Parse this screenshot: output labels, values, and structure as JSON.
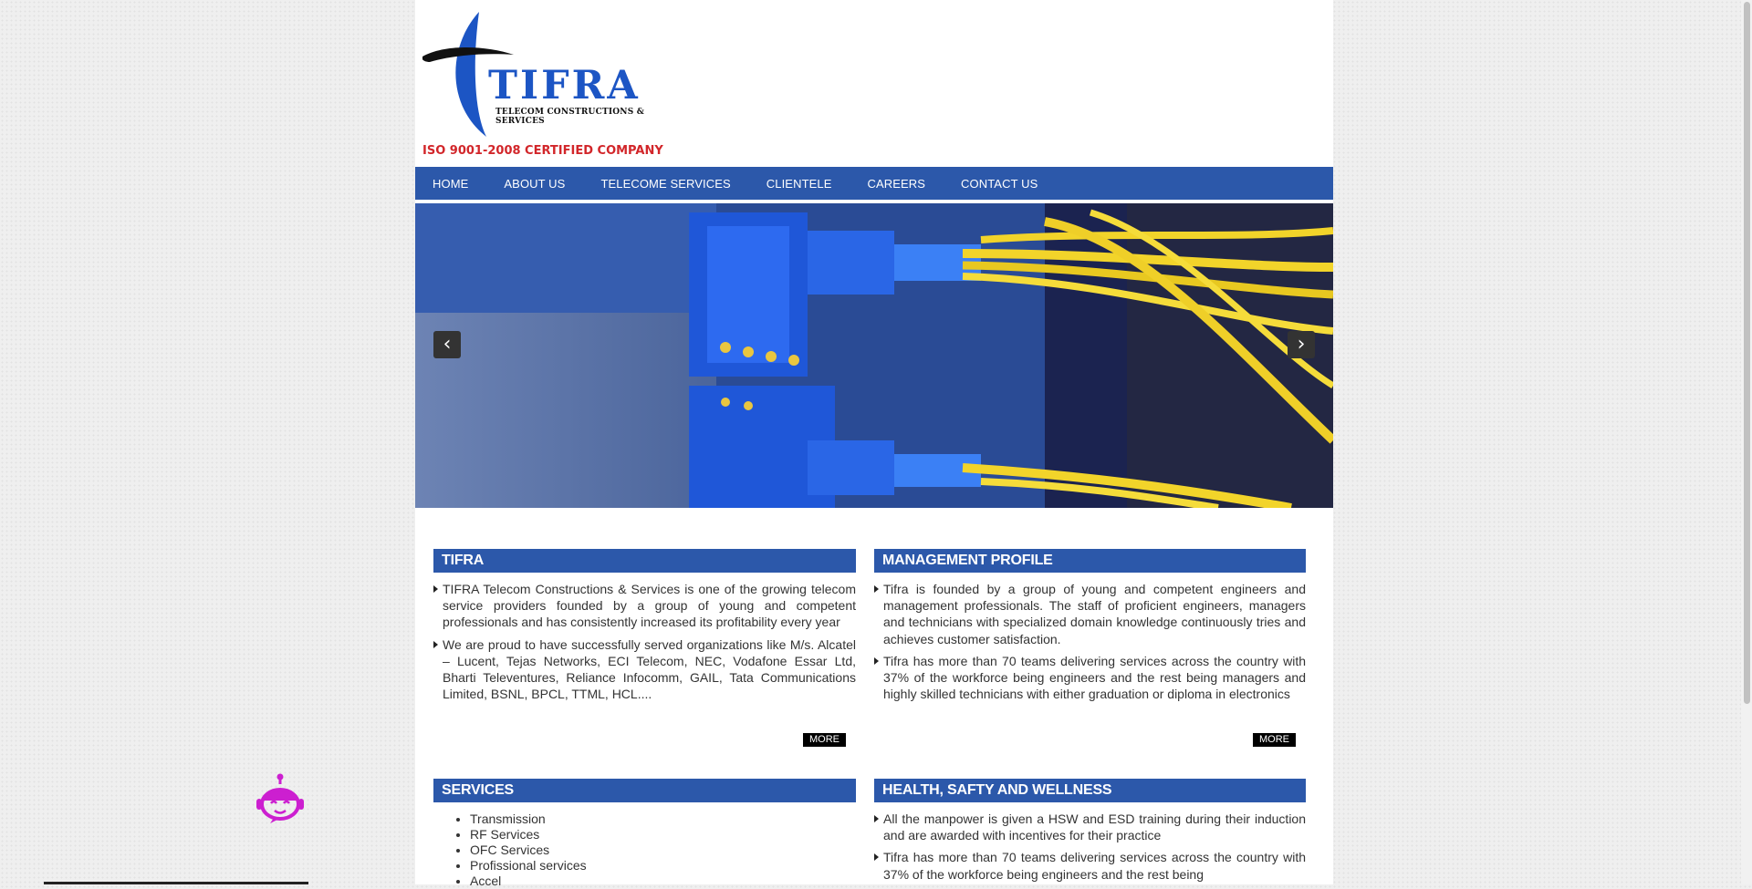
{
  "logo": {
    "name": "TIFRA",
    "subtitle": "TELECOM CONSTRUCTIONS & SERVICES",
    "certification": "ISO 9001-2008 CERTIFIED COMPANY"
  },
  "nav": {
    "items": [
      {
        "label": "HOME"
      },
      {
        "label": "ABOUT US"
      },
      {
        "label": "TELECOME SERVICES"
      },
      {
        "label": "CLIENTELE"
      },
      {
        "label": "CAREERS"
      },
      {
        "label": "CONTACT US"
      }
    ]
  },
  "slider": {
    "prev_label": "‹",
    "next_label": "›"
  },
  "tifra": {
    "heading": "TIFRA",
    "paragraphs": [
      "TIFRA Telecom Constructions & Services is one of the growing telecom service providers founded by a group of young and competent professionals and has consistently increased its profitability every year",
      "We are proud to have successfully served organizations like M/s. Alcatel – Lucent, Tejas Networks, ECI Telecom, NEC, Vodafone Essar Ltd, Bharti Televentures, Reliance Infocomm, GAIL, Tata Communications Limited, BSNL, BPCL, TTML, HCL...."
    ],
    "more_label": "MORE"
  },
  "management": {
    "heading": "MANAGEMENT PROFILE",
    "paragraphs": [
      "Tifra is founded by a group of young and competent engineers and management professionals. The staff of proficient engineers, managers and technicians with specialized domain knowledge continuously tries and achieves customer satisfaction.",
      "Tifra has more than 70 teams delivering services across the country with 37% of the workforce being engineers and the rest being managers and highly skilled technicians with either graduation or diploma in electronics"
    ],
    "more_label": "MORE"
  },
  "services": {
    "heading": "SERVICES",
    "items": [
      "Transmission",
      "RF Services",
      "OFC Services",
      "Profissional services",
      "Accel"
    ]
  },
  "health": {
    "heading": "HEALTH, SAFTY AND WELLNESS",
    "paragraphs": [
      "All the manpower is given a HSW and ESD training during their induction and are awarded with incentives for their practice",
      "Tifra has more than 70 teams delivering services across the country with 37% of the workforce being engineers and the rest being"
    ]
  },
  "colors": {
    "brand_blue": "#2c58aa",
    "logo_red": "#d2262a",
    "robot_magenta": "#cc1fd0"
  }
}
